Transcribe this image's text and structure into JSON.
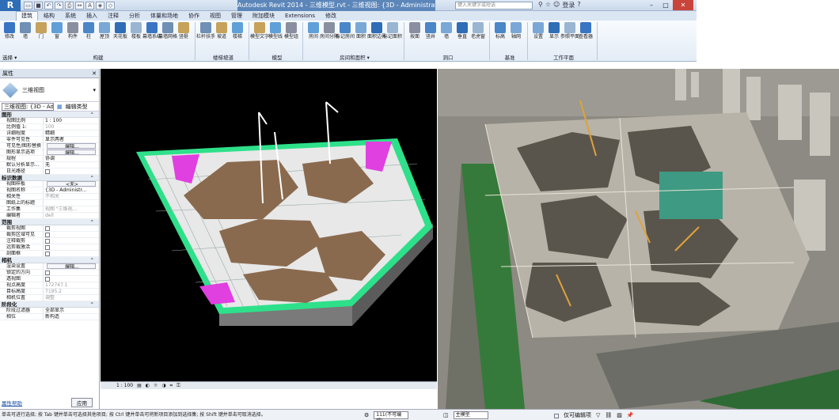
{
  "app": {
    "title": "Autodesk Revit 2014 - 三维模型.rvt - 三维视图: {3D - Administrator}",
    "search_placeholder": "键入关键字或短语",
    "signin": "登录",
    "help": "?",
    "brand_color": "#2f6db6"
  },
  "tabs": [
    "建筑",
    "结构",
    "系统",
    "插入",
    "注释",
    "分析",
    "体量和场地",
    "协作",
    "视图",
    "管理",
    "附加模块",
    "Extensions",
    "修改"
  ],
  "ribbon": {
    "select_label": "选择 ▾",
    "panels": [
      {
        "label": "构建",
        "tools": [
          "修改",
          "墙",
          "门",
          "窗",
          "构件",
          "柱",
          "屋顶",
          "天花板",
          "楼板",
          "幕墙系统",
          "幕墙网格",
          "竖梃"
        ]
      },
      {
        "label": "楼梯坡道",
        "tools": [
          "栏杆扶手",
          "坡道",
          "楼梯"
        ]
      },
      {
        "label": "模型",
        "tools": [
          "模型文字",
          "模型线",
          "模型组"
        ]
      },
      {
        "label": "房间和面积 ▾",
        "tools": [
          "房间",
          "房间分隔",
          "标记房间",
          "面积",
          "面积边界",
          "标记面积"
        ]
      },
      {
        "label": "洞口",
        "tools": [
          "按面",
          "竖井",
          "墙",
          "垂直",
          "老虎窗"
        ]
      },
      {
        "label": "基准",
        "tools": [
          "标高",
          "轴网"
        ]
      },
      {
        "label": "工作平面",
        "tools": [
          "设置",
          "显示",
          "参照平面",
          "查看器"
        ]
      }
    ]
  },
  "properties": {
    "header": "属性",
    "type_name": "三维视图",
    "view_selector": "三维视图: {3D - Admi",
    "edit_type": "编辑类型",
    "sections": [
      {
        "title": "图形",
        "rows": [
          {
            "k": "视图比例",
            "v": "1 : 100",
            "kind": "text"
          },
          {
            "k": "比例值 1:",
            "v": "100",
            "kind": "grey"
          },
          {
            "k": "详细程度",
            "v": "精细",
            "kind": "text"
          },
          {
            "k": "零件可见性",
            "v": "显示两者",
            "kind": "text"
          },
          {
            "k": "可见性/图形替换",
            "v": "编辑...",
            "kind": "btn"
          },
          {
            "k": "图形显示选项",
            "v": "编辑...",
            "kind": "btn"
          },
          {
            "k": "规程",
            "v": "协调",
            "kind": "text"
          },
          {
            "k": "默认分析显示...",
            "v": "无",
            "kind": "text"
          },
          {
            "k": "日光路径",
            "v": "",
            "kind": "chk"
          }
        ]
      },
      {
        "title": "标识数据",
        "rows": [
          {
            "k": "视图样板",
            "v": "<无>",
            "kind": "btn"
          },
          {
            "k": "视图名称",
            "v": "{3D - Administr...",
            "kind": "text"
          },
          {
            "k": "相关性",
            "v": "不相关",
            "kind": "grey"
          },
          {
            "k": "图纸上的标题",
            "v": "",
            "kind": "text"
          },
          {
            "k": "工作集",
            "v": "视图 \"三维视...",
            "kind": "grey"
          },
          {
            "k": "编辑者",
            "v": "dell",
            "kind": "grey"
          }
        ]
      },
      {
        "title": "范围",
        "rows": [
          {
            "k": "裁剪视图",
            "v": "",
            "kind": "chk"
          },
          {
            "k": "裁剪区域可见",
            "v": "",
            "kind": "chk"
          },
          {
            "k": "注释裁剪",
            "v": "",
            "kind": "chk"
          },
          {
            "k": "远剪裁激活",
            "v": "",
            "kind": "chk"
          },
          {
            "k": "剖面框",
            "v": "",
            "kind": "chk"
          }
        ]
      },
      {
        "title": "相机",
        "rows": [
          {
            "k": "渲染设置",
            "v": "编辑...",
            "kind": "btn"
          },
          {
            "k": "锁定的方向",
            "v": "",
            "kind": "chk"
          },
          {
            "k": "透视图",
            "v": "",
            "kind": "chk"
          },
          {
            "k": "视点高度",
            "v": "172747.1",
            "kind": "grey"
          },
          {
            "k": "目标高度",
            "v": "7195.2",
            "kind": "grey"
          },
          {
            "k": "相机位置",
            "v": "调整",
            "kind": "grey"
          }
        ]
      },
      {
        "title": "阶段化",
        "rows": [
          {
            "k": "阶段过滤器",
            "v": "全部显示",
            "kind": "text"
          },
          {
            "k": "相位",
            "v": "新构造",
            "kind": "text"
          }
        ]
      }
    ],
    "help_link": "属性帮助",
    "apply": "应用"
  },
  "viewbar": {
    "scale": "1 : 100"
  },
  "status": {
    "text": "单击可进行选择; 按 Tab 键并单击可选择其他项目; 按 Ctrl 键并单击可将新项目添加到选择集; 按 Shift 键并单击可取消选择。",
    "workset": "111(不可编辑)",
    "main_model": "主模型",
    "editable_only": "仅可编辑项"
  }
}
